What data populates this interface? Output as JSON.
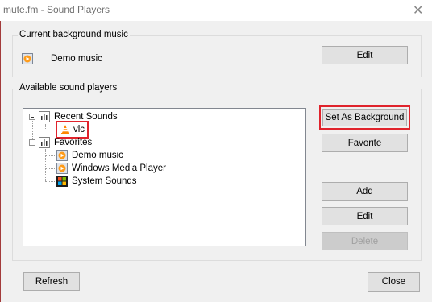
{
  "window": {
    "title": "mute.fm - Sound Players",
    "close_glyph": "✕"
  },
  "current": {
    "group_label": "Current background music",
    "item_label": "Demo music",
    "item_icon": "media-player-icon",
    "edit_label": "Edit"
  },
  "available": {
    "group_label": "Available sound players",
    "tree": {
      "recent": {
        "label": "Recent Sounds",
        "icon": "equalizer-icon",
        "children": [
          {
            "label": "vlc",
            "icon": "vlc-cone-icon",
            "highlighted": true
          }
        ]
      },
      "favorites": {
        "label": "Favorites",
        "icon": "equalizer-icon",
        "children": [
          {
            "label": "Demo music",
            "icon": "media-player-icon"
          },
          {
            "label": "Windows Media Player",
            "icon": "media-player-icon"
          },
          {
            "label": "System Sounds",
            "icon": "windows-logo-icon"
          }
        ]
      }
    },
    "buttons": {
      "set_background": "Set As Background",
      "favorite": "Favorite",
      "add": "Add",
      "edit": "Edit",
      "delete": "Delete"
    }
  },
  "footer": {
    "refresh": "Refresh",
    "close": "Close"
  },
  "colors": {
    "highlight": "#e0232c",
    "window_border": "#a33b3b",
    "background": "#f0f0f0"
  }
}
